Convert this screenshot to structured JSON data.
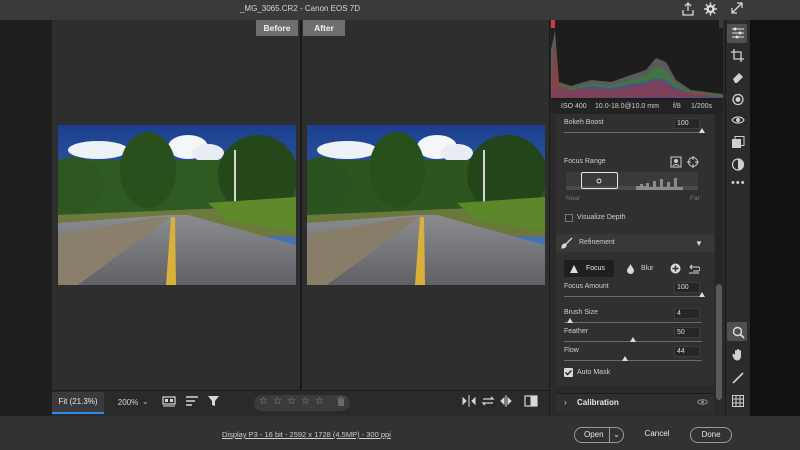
{
  "window": {
    "title": "_MG_3065.CR2  -  Canon EOS 7D"
  },
  "titlebar_icons": [
    "share-icon",
    "gear-icon",
    "expand-icon"
  ],
  "compare": {
    "before_label": "Before",
    "after_label": "After"
  },
  "toolbar": {
    "zoom_fit": "Fit (21.3%)",
    "zoom_200": "200%",
    "zoom_dropdown": "⌄",
    "icons": [
      "filmstrip-icon",
      "sort-icon",
      "filter-icon"
    ],
    "rating_stars": 5,
    "view_icons": [
      "swap-icon",
      "copy-settings-icon",
      "swap-sides-icon",
      "toggle-view-icon"
    ]
  },
  "footer": {
    "file_info": "Display P3 - 16 bit - 2592 x 1728 (4.5MP) - 300 ppi",
    "open_label": "Open",
    "open_dropdown": "⌄",
    "cancel_label": "Cancel",
    "done_label": "Done"
  },
  "camera_info": {
    "iso": "ISO 400",
    "lens": "10.0-18.0@10.0 mm",
    "aperture": "f/8",
    "shutter": "1/200s"
  },
  "lens_blur": {
    "bokeh_boost": {
      "label": "Bokeh Boost",
      "value": "100",
      "level": 1.0
    },
    "focus_range": {
      "label": "Focus Range",
      "near": "Near",
      "far": "Far"
    },
    "visualize_depth": {
      "label": "Visualize Depth",
      "checked": false
    }
  },
  "refinement": {
    "title": "Refinement",
    "focus_label": "Focus",
    "blur_label": "Blur",
    "focus_amount": {
      "label": "Focus Amount",
      "value": "100",
      "level": 1.0
    },
    "brush_size": {
      "label": "Brush Size",
      "value": "4",
      "level": 0.04
    },
    "feather": {
      "label": "Feather",
      "value": "50",
      "level": 0.5
    },
    "flow": {
      "label": "Flow",
      "value": "44",
      "level": 0.44
    },
    "auto_mask": {
      "label": "Auto Mask",
      "checked": true
    }
  },
  "calibration": {
    "label": "Calibration"
  },
  "side_tools": [
    "edit-icon",
    "crop-icon",
    "eraser-icon",
    "mask-icon",
    "redeye-icon",
    "presets-icon",
    "snapshots-icon",
    "more-icon",
    "zoom-icon",
    "hand-icon",
    "sampler-icon",
    "grid-icon"
  ]
}
